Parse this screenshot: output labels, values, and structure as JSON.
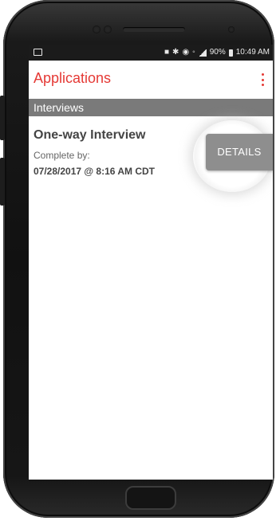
{
  "status_bar": {
    "battery": "90%",
    "time": "10:49 AM",
    "icons": [
      "image-icon",
      "alarm-icon",
      "bluetooth-icon",
      "clock-icon",
      "wifi-icon",
      "signal-icon",
      "battery-icon"
    ]
  },
  "app_bar": {
    "title": "Applications",
    "menu_icon": "more-vert-icon",
    "accent_color": "#e53935"
  },
  "section": {
    "title": "Interviews",
    "color": "#7a7a7a"
  },
  "interview": {
    "title": "One-way Interview",
    "complete_label": "Complete by:",
    "due": "07/28/2017 @ 8:16 AM CDT",
    "details_label": "DETAILS"
  }
}
